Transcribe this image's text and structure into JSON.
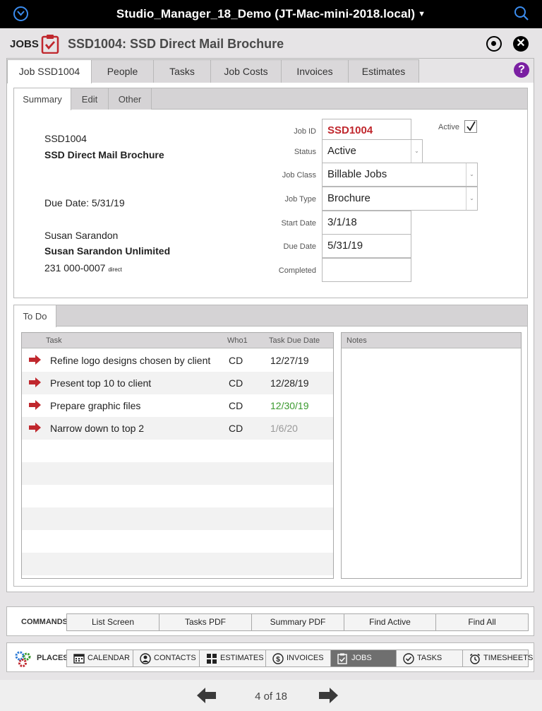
{
  "window": {
    "title": "Studio_Manager_18_Demo (JT-Mac-mini-2018.local)"
  },
  "header": {
    "section_label": "JOBS",
    "record_title": "SSD1004: SSD Direct Mail Brochure"
  },
  "tabs": [
    "Job SSD1004",
    "People",
    "Tasks",
    "Job Costs",
    "Invoices",
    "Estimates"
  ],
  "subtabs": [
    "Summary",
    "Edit",
    "Other"
  ],
  "summary": {
    "job_code": "SSD1004",
    "job_name": "SSD Direct Mail Brochure",
    "due_line": "Due Date: 5/31/19",
    "contact_name": "Susan Sarandon",
    "company": "Susan Sarandon Unlimited",
    "phone": "231 000-0007",
    "phone_type": "direct"
  },
  "fields": {
    "job_id_label": "Job ID",
    "job_id": "SSD1004",
    "status_label": "Status",
    "status": "Active",
    "job_class_label": "Job Class",
    "job_class": "Billable Jobs",
    "job_type_label": "Job Type",
    "job_type": "Brochure",
    "start_date_label": "Start Date",
    "start_date": "3/1/18",
    "due_date_label": "Due Date",
    "due_date": "5/31/19",
    "completed_label": "Completed",
    "completed": "",
    "active_label": "Active",
    "active_checked": true
  },
  "todo": {
    "tab_label": "To Do",
    "columns": {
      "task": "Task",
      "who": "Who1",
      "due": "Task Due Date"
    },
    "rows": [
      {
        "task": "Refine logo designs chosen by client",
        "who": "CD",
        "due": "12/27/19",
        "due_color": "#222222"
      },
      {
        "task": "Present top 10 to client",
        "who": "CD",
        "due": "12/28/19",
        "due_color": "#222222"
      },
      {
        "task": "Prepare graphic files",
        "who": "CD",
        "due": "12/30/19",
        "due_color": "#3a9a2e"
      },
      {
        "task": "Narrow down to top 2",
        "who": "CD",
        "due": "1/6/20",
        "due_color": "#999999"
      }
    ],
    "notes_label": "Notes"
  },
  "commands": {
    "label": "COMMANDS:",
    "buttons": [
      "List Screen",
      "Tasks PDF",
      "Summary PDF",
      "Find Active",
      "Find All"
    ]
  },
  "places": {
    "label": "PLACES:",
    "buttons": [
      {
        "label": "CALENDAR",
        "icon": "calendar-icon"
      },
      {
        "label": "CONTACTS",
        "icon": "contact-icon"
      },
      {
        "label": "ESTIMATES",
        "icon": "grid-icon"
      },
      {
        "label": "INVOICES",
        "icon": "dollar-icon"
      },
      {
        "label": "JOBS",
        "icon": "clipboard-icon"
      },
      {
        "label": "TASKS",
        "icon": "check-circle-icon"
      },
      {
        "label": "TIMESHEETS",
        "icon": "alarm-clock-icon"
      }
    ],
    "active": "JOBS"
  },
  "nav": {
    "page_indicator": "4 of 18"
  },
  "colors": {
    "accent_red": "#c0272d",
    "help_purple": "#7a1fa2",
    "ios_blue": "#3b8df0"
  }
}
